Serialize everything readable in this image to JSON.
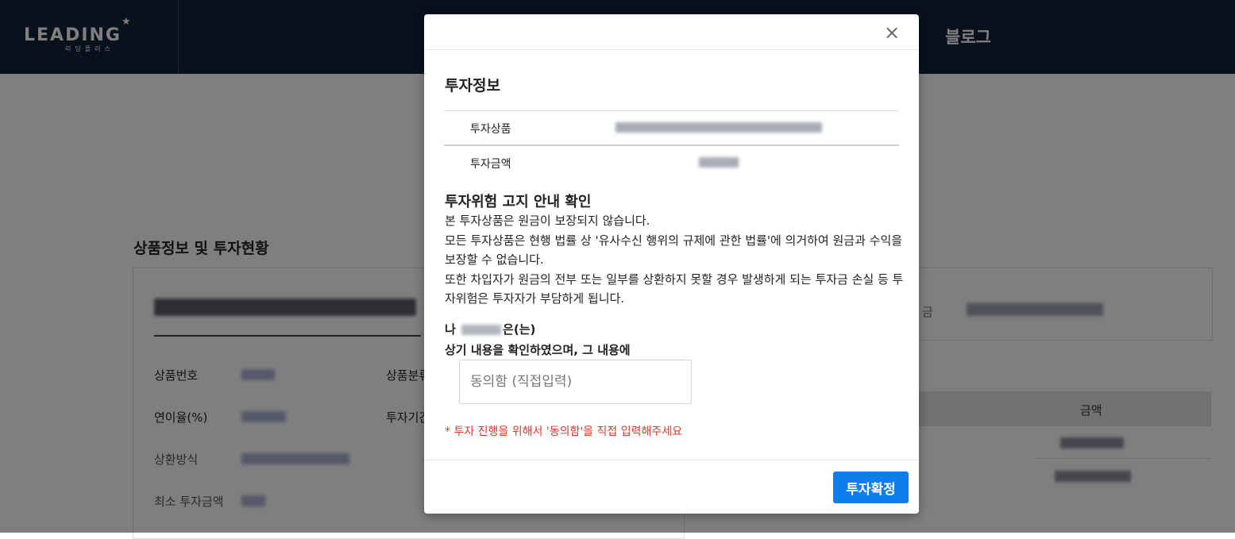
{
  "header": {
    "logo_main": "LEADING",
    "logo_sub": "리딩플러스",
    "nav_blog": "블로그"
  },
  "page": {
    "section_title": "상품정보 및 투자현황",
    "info_labels": [
      "상품번호",
      "상품분류",
      "연이율(%)",
      "투자기간",
      "상환방식",
      "최소 투자금액"
    ],
    "right_label": "금",
    "table_header": "금액"
  },
  "modal": {
    "close_icon": "×",
    "title": "투자정보",
    "rows": [
      {
        "label": "투자상품"
      },
      {
        "label": "투자금액"
      }
    ],
    "risk_title": "투자위험 고지 안내 확인",
    "risk_lines": [
      "본 투자상품은 원금이 보장되지 않습니다.",
      "모든 투자상품은 현행 법률 상 '유사수신 행위의 규제에 관한 법률'에 의거하여 원금과 수익을 보장할 수 없습니다.",
      "또한 차입자가 원금의 전부 또는 일부를 상환하지 못할 경우 발생하게 되는 투자금 손실 등 투자위험은 투자자가 부담하게 됩니다."
    ],
    "agree_prefix": "나",
    "agree_suffix": "은(는)",
    "agree_line2": "상기 내용을 확인하였으며, 그 내용에",
    "agree_placeholder": "동의함 (직접입력)",
    "agree_value": "",
    "warning": "* 투자 진행을 위해서 '동의함'을 직접 입력해주세요",
    "confirm_label": "투자확정"
  },
  "colors": {
    "header_bg": "#13223a",
    "confirm_bg": "#0d7df0",
    "warning": "#e0352b"
  }
}
